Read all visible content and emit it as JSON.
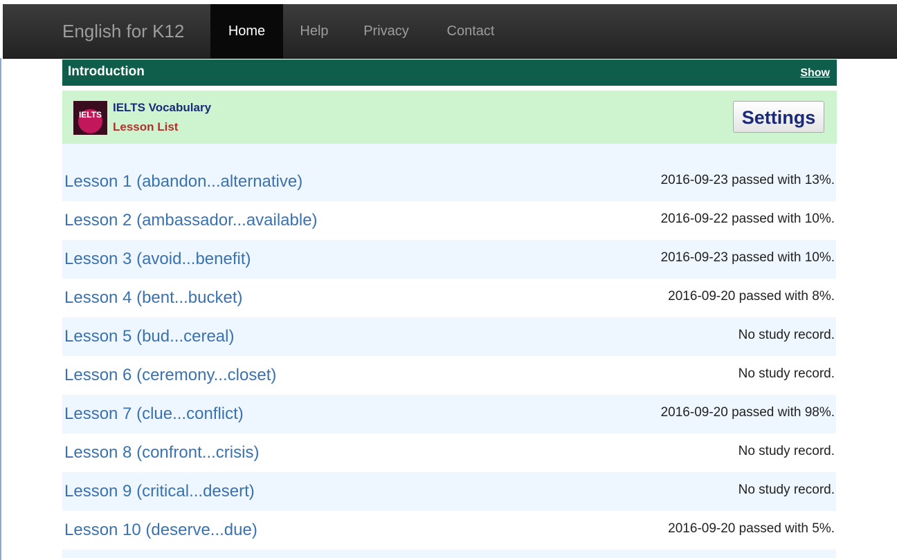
{
  "navbar": {
    "brand": "English for K12",
    "items": [
      {
        "label": "Home",
        "active": true
      },
      {
        "label": "Help",
        "active": false
      },
      {
        "label": "Privacy",
        "active": false
      },
      {
        "label": "Contact",
        "active": false
      }
    ]
  },
  "intro": {
    "title": "Introduction",
    "toggle_label": "Show"
  },
  "course": {
    "logo_text": "IELTS",
    "title": "IELTS Vocabulary",
    "subtitle": "Lesson List",
    "settings_label": "Settings"
  },
  "lessons": [
    {
      "label": "Lesson 1 (abandon...alternative)",
      "status": "2016-09-23 passed with 13%."
    },
    {
      "label": "Lesson 2 (ambassador...available)",
      "status": "2016-09-22 passed with 10%."
    },
    {
      "label": "Lesson 3 (avoid...benefit)",
      "status": "2016-09-23 passed with 10%."
    },
    {
      "label": "Lesson 4 (bent...bucket)",
      "status": "2016-09-20 passed with 8%."
    },
    {
      "label": "Lesson 5 (bud...cereal)",
      "status": "No study record."
    },
    {
      "label": "Lesson 6 (ceremony...closet)",
      "status": "No study record."
    },
    {
      "label": "Lesson 7 (clue...conflict)",
      "status": "2016-09-20 passed with 98%."
    },
    {
      "label": "Lesson 8 (confront...crisis)",
      "status": "No study record."
    },
    {
      "label": "Lesson 9 (critical...desert)",
      "status": "No study record."
    },
    {
      "label": "Lesson 10 (deserve...due)",
      "status": "2016-09-20 passed with 5%."
    }
  ]
}
